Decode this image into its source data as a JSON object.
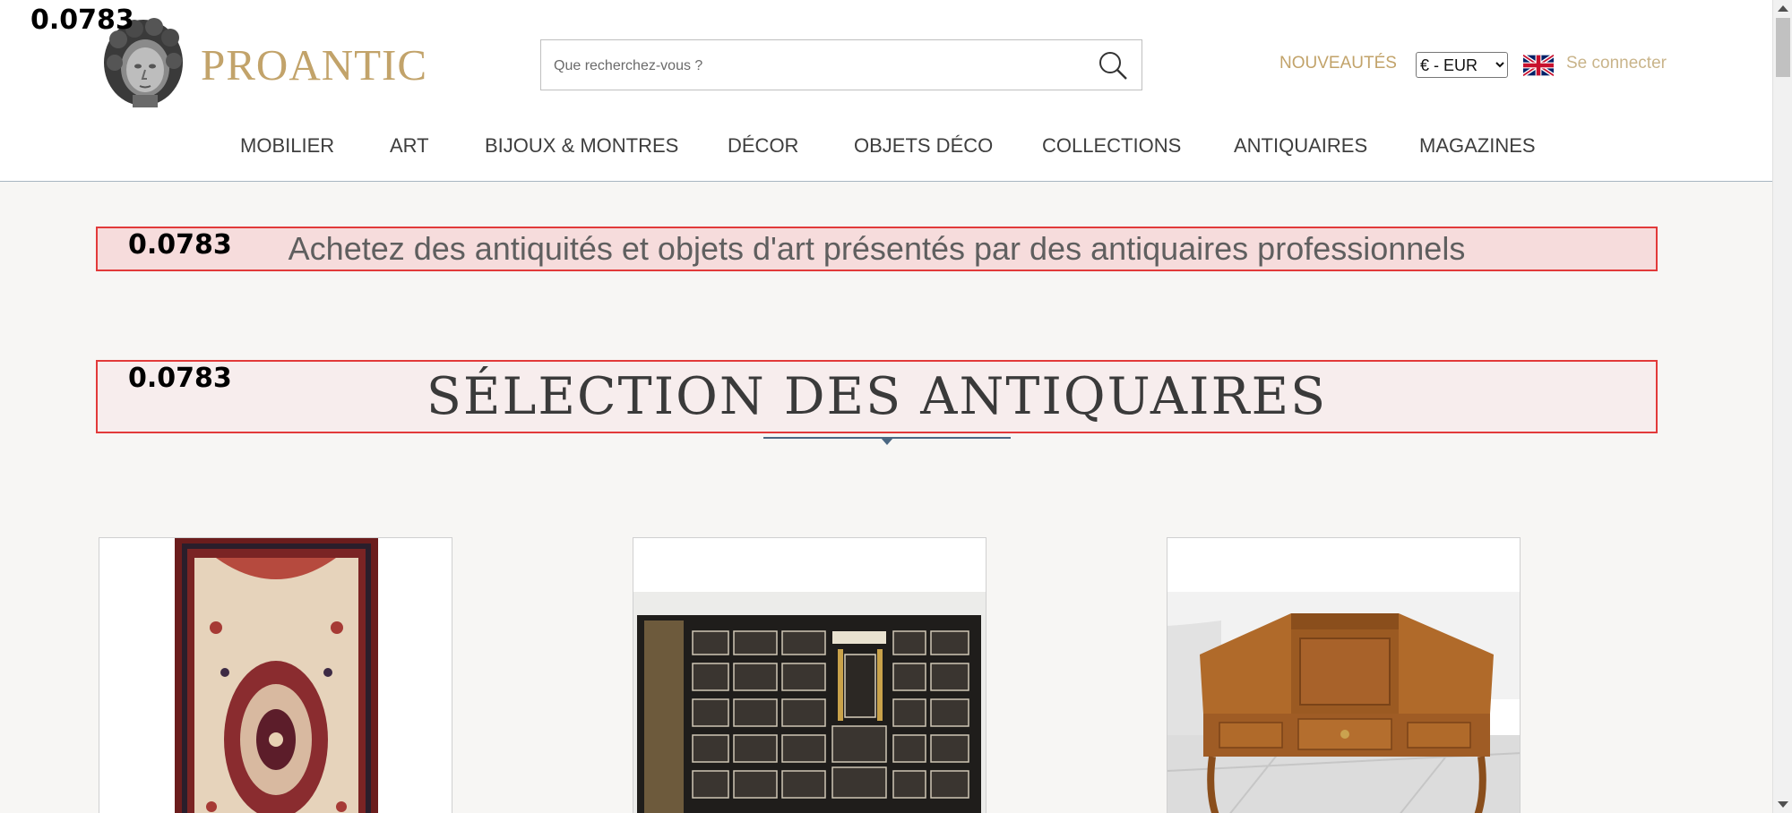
{
  "scores": [
    "0.0783",
    "0.0783",
    "0.0783"
  ],
  "brand": {
    "name": "PROANTIC"
  },
  "search": {
    "placeholder": "Que recherchez-vous ?"
  },
  "header": {
    "new_label": "NOUVEAUTÉS",
    "currency": "€ - EUR",
    "language": "uk-flag-icon",
    "login_label": "Se connecter"
  },
  "nav": {
    "items": [
      "MOBILIER",
      "ART",
      "BIJOUX & MONTRES",
      "DÉCOR",
      "OBJETS DÉCO",
      "COLLECTIONS",
      "ANTIQUAIRES",
      "MAGAZINES"
    ]
  },
  "hero": {
    "tagline": "Achetez des antiquités et objets d'art présentés par des antiquaires professionnels"
  },
  "selection": {
    "title": "SÉLECTION DES ANTIQUAIRES"
  },
  "products": [
    {
      "image": "persian-rug-image"
    },
    {
      "image": "inlaid-cabinet-image"
    },
    {
      "image": "wooden-dressing-table-image"
    }
  ],
  "colors": {
    "gold": "#c2a36a",
    "highlight_border": "#e23a3a",
    "rule": "#4a6782"
  }
}
